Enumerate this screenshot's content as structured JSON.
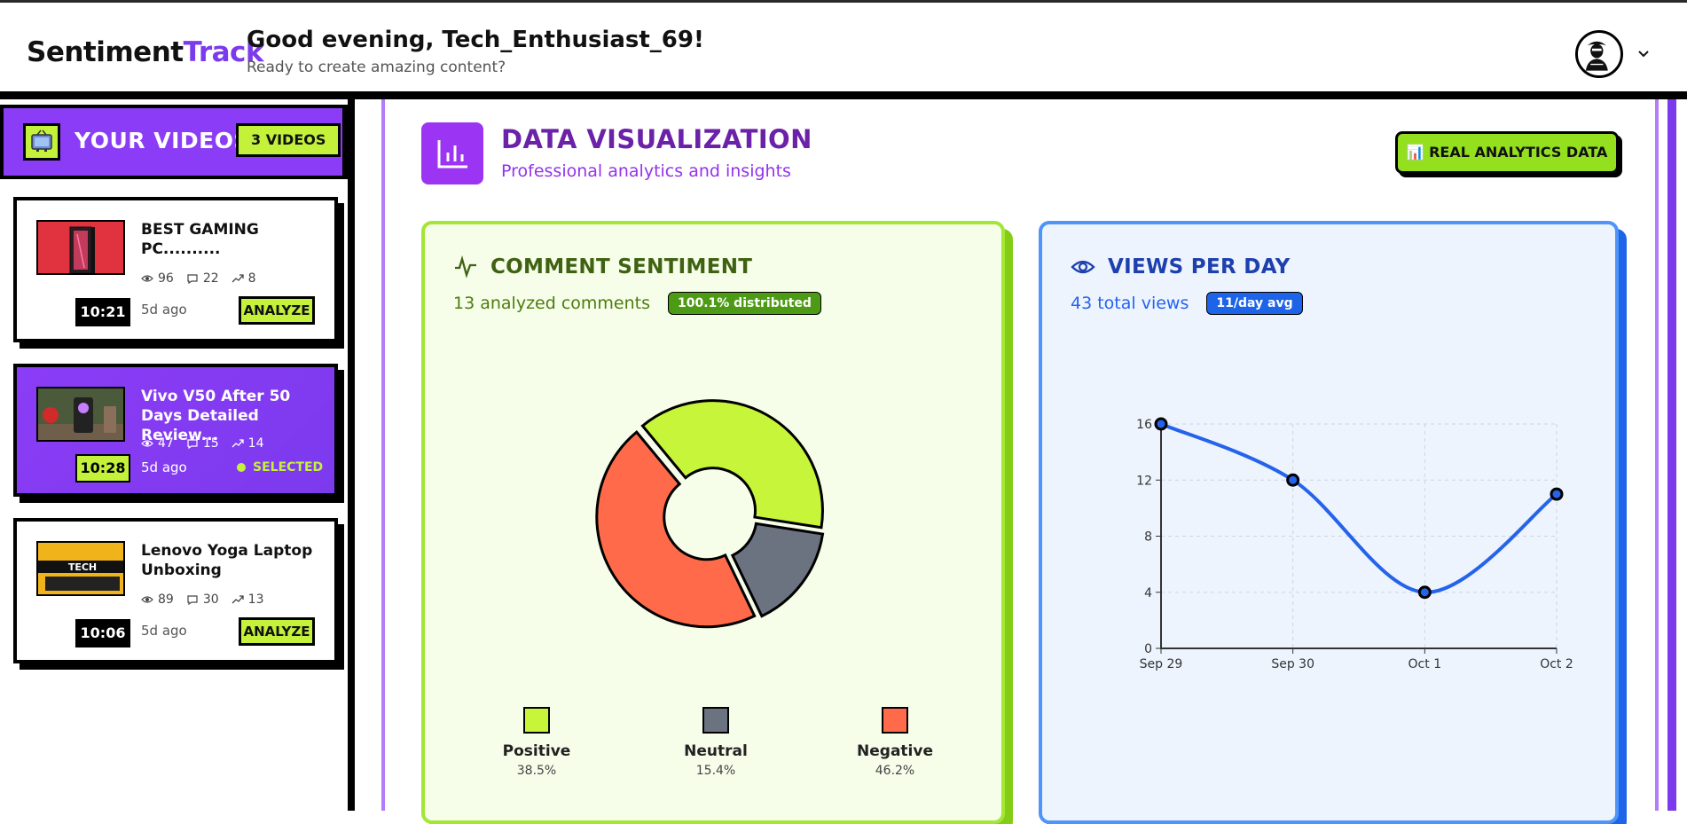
{
  "header": {
    "logo_main": "Sentiment",
    "logo_accent": "Track",
    "greeting": "Good evening, Tech_Enthusiast_69!",
    "subgreeting": "Ready to create amazing content?"
  },
  "sidebar": {
    "title": "YOUR VIDEOS",
    "count": "3 VIDEOS",
    "videos": [
      {
        "title": "BEST GAMING PC..........",
        "views": "96",
        "comments": "22",
        "trend": "8",
        "duration": "10:21",
        "ago": "5d ago",
        "action": "ANALYZE"
      },
      {
        "title": "Vivo V50 After 50 Days Detailed Review...",
        "views": "47",
        "comments": "15",
        "trend": "14",
        "duration": "10:28",
        "ago": "5d ago",
        "status": "SELECTED"
      },
      {
        "title": "Lenovo Yoga Laptop Unboxing",
        "views": "89",
        "comments": "30",
        "trend": "13",
        "duration": "10:06",
        "ago": "5d ago",
        "action": "ANALYZE"
      }
    ]
  },
  "main": {
    "title": "DATA VISUALIZATION",
    "subtitle": "Professional analytics and insights",
    "badge": "📊 REAL ANALYTICS DATA"
  },
  "sentiment": {
    "title": "COMMENT SENTIMENT",
    "summary": "13 analyzed comments",
    "pill": "100.1% distributed",
    "legend": [
      {
        "label": "Positive",
        "pct": "38.5%"
      },
      {
        "label": "Neutral",
        "pct": "15.4%"
      },
      {
        "label": "Negative",
        "pct": "46.2%"
      }
    ]
  },
  "views": {
    "title": "VIEWS PER DAY",
    "summary": "43 total views",
    "pill": "11/day avg"
  },
  "chart_data": [
    {
      "type": "pie",
      "categories": [
        "Positive",
        "Neutral",
        "Negative"
      ],
      "values": [
        38.5,
        15.4,
        46.2
      ],
      "colors": [
        "#c6f53a",
        "#6b7280",
        "#ff6b4a"
      ]
    },
    {
      "type": "line",
      "categories": [
        "Sep 29",
        "Sep 30",
        "Oct 1",
        "Oct 2"
      ],
      "values": [
        16,
        12,
        4,
        11
      ],
      "ylim": [
        0,
        16
      ],
      "yticks": [
        0,
        4,
        8,
        12,
        16
      ],
      "grid": true,
      "color": "#2563eb"
    }
  ],
  "colors": {
    "accent": "#7c3aed",
    "lime": "#c4f23a",
    "blue": "#2563eb"
  }
}
